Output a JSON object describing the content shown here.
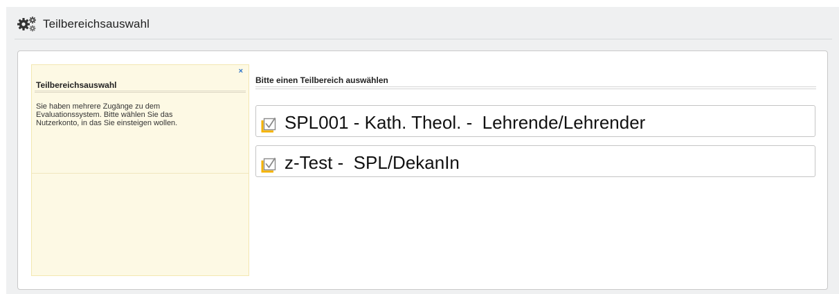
{
  "page": {
    "title": "Teilbereichsauswahl",
    "icon": "gears-icon"
  },
  "help": {
    "title": "Teilbereichsauswahl",
    "close_label": "×",
    "text": "Sie haben mehrere Zugänge zu dem Evaluationssystem. Bitte wählen Sie das Nutzerkonto, in das Sie einsteigen wollen."
  },
  "selection": {
    "heading": "Bitte einen Teilbereich auswählen",
    "options": [
      {
        "label": "SPL001 - Kath. Theol. -  Lehrende/Lehrender",
        "icon": "checkbox-checked-icon"
      },
      {
        "label": "z-Test -  SPL/DekanIn",
        "icon": "checkbox-checked-icon"
      }
    ]
  },
  "colors": {
    "background": "#eff0f1",
    "help_background": "#fdf9e4",
    "check_yellow": "#f5b301",
    "check_gray": "#8a8a8a",
    "close_blue": "#2d73c8"
  }
}
